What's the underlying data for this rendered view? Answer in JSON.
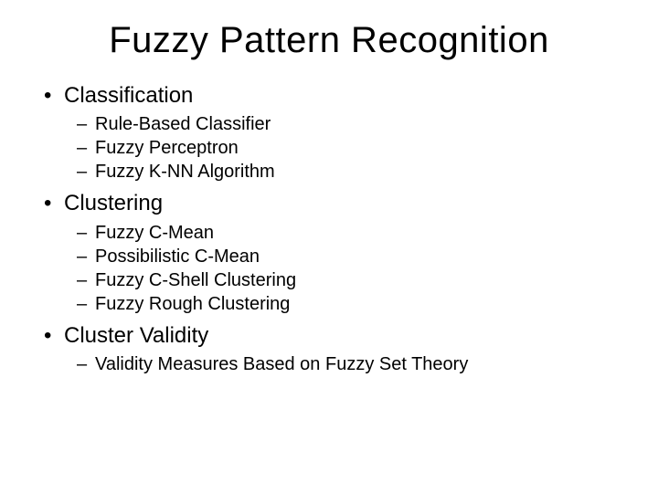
{
  "title": "Fuzzy Pattern Recognition",
  "bullets": [
    {
      "label": "Classification",
      "sub": [
        "Rule-Based Classifier",
        "Fuzzy Perceptron",
        "Fuzzy K-NN Algorithm"
      ]
    },
    {
      "label": "Clustering",
      "sub": [
        "Fuzzy C-Mean",
        "Possibilistic C-Mean",
        "Fuzzy C-Shell Clustering",
        "Fuzzy Rough Clustering"
      ]
    },
    {
      "label": "Cluster Validity",
      "sub": [
        "Validity Measures Based on Fuzzy Set Theory"
      ]
    }
  ]
}
